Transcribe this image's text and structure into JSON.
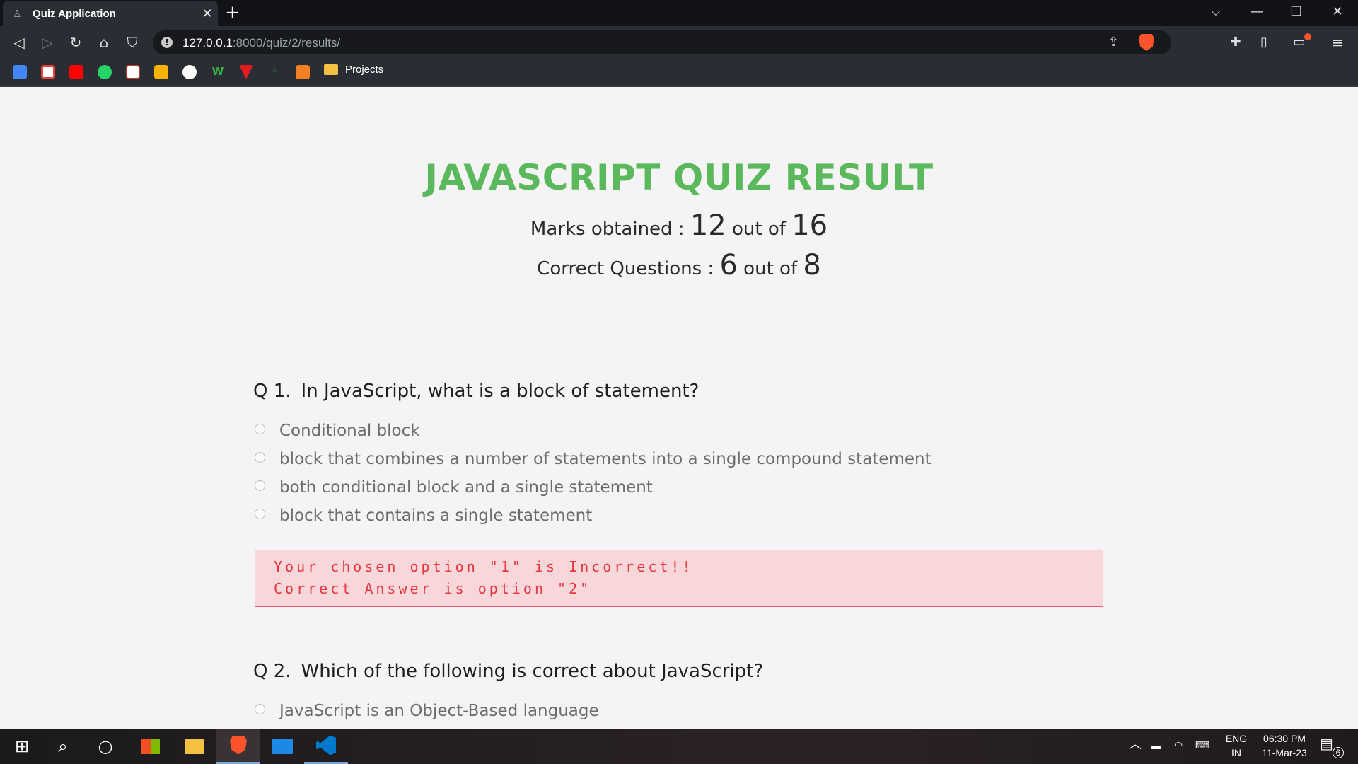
{
  "browser": {
    "tab_title": "Quiz Application",
    "tab_close": "✕",
    "new_tab": "+",
    "url_host": "127.0.0.1",
    "url_rest": ":8000/quiz/2/results/",
    "bookmark_folder": "Projects",
    "window_controls": [
      "⌵",
      "—",
      "❐",
      "✕"
    ]
  },
  "quiz": {
    "title": "JAVASCRIPT QUIZ RESULT",
    "marks_label": "Marks obtained : ",
    "marks_obtained": "12",
    "marks_sep": " out of ",
    "marks_total": "16",
    "correct_label": "Correct Questions : ",
    "correct_count": "6",
    "correct_sep": " out of ",
    "correct_total": "8",
    "questions": [
      {
        "number": "Q 1.",
        "text": "In JavaScript, what is a block of statement?",
        "options": [
          "Conditional block",
          "block that combines a number of statements into a single compound statement",
          "both conditional block and a single statement",
          "block that contains a single statement"
        ],
        "feedback_line1": "Your chosen option \"1\" is Incorrect!!",
        "feedback_line2": "Correct Answer is option \"2\""
      },
      {
        "number": "Q 2.",
        "text": "Which of the following is correct about JavaScript?",
        "options": [
          "JavaScript is an Object-Based language"
        ]
      }
    ]
  },
  "taskbar": {
    "lang_line1": "ENG",
    "lang_line2": "IN",
    "time": "06:30 PM",
    "date": "11-Mar-23",
    "notification_count": "6"
  },
  "colors": {
    "title_green": "#5cb85c",
    "error_red": "#e8343d",
    "error_bg": "#f8d7da"
  }
}
